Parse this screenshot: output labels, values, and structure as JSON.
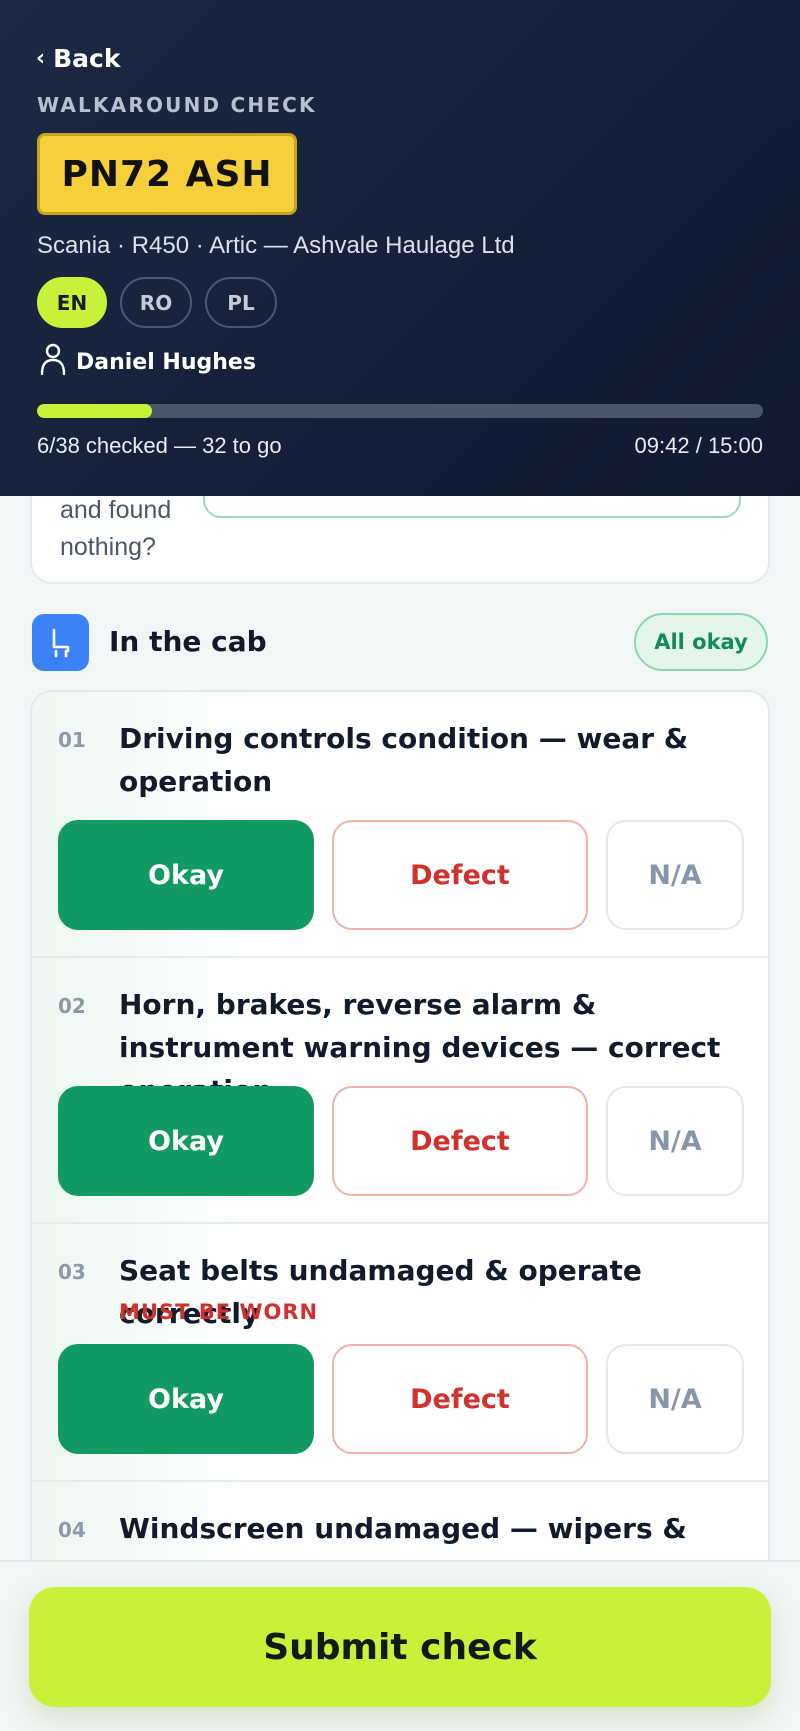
{
  "header": {
    "back_label": "Back",
    "eyebrow": "WALKAROUND CHECK",
    "plate": "PN72 ASH",
    "vehicle_line": "Scania · R450 · Artic — Ashvale Haulage Ltd",
    "languages": [
      {
        "code": "EN",
        "active": true
      },
      {
        "code": "RO",
        "active": false
      },
      {
        "code": "PL",
        "active": false
      }
    ],
    "driver_name": "Daniel Hughes",
    "progress": {
      "checked": 6,
      "total": 38,
      "fraction": 0.158
    },
    "progress_text": "6/38 checked — 32 to go",
    "timer": "09:42 / 15:00"
  },
  "previous_card": {
    "text": "and found nothing?"
  },
  "section": {
    "title": "In the cab",
    "all_okay_label": "All okay",
    "icon": "seat-icon",
    "icon_color": "#3b82f6"
  },
  "items": [
    {
      "num": "01",
      "title": "Driving controls condition — wear & operation",
      "note": "",
      "okay": "Okay",
      "defect": "Defect",
      "na": "N/A",
      "selected": "okay"
    },
    {
      "num": "02",
      "title": "Horn, brakes, reverse alarm & instrument warning devices — correct operation",
      "note": "",
      "okay": "Okay",
      "defect": "Defect",
      "na": "N/A",
      "selected": "okay"
    },
    {
      "num": "03",
      "title": "Seat belts undamaged & operate correctly",
      "note": "MUST BE WORN",
      "okay": "Okay",
      "defect": "Defect",
      "na": "N/A",
      "selected": "okay"
    },
    {
      "num": "04",
      "title": "Windscreen undamaged — wipers &"
    }
  ],
  "footer": {
    "submit_label": "Submit check"
  },
  "colors": {
    "accent": "#c7f23a",
    "okay": "#129a62",
    "defect": "#d0312d",
    "header_bg": "#172339"
  }
}
